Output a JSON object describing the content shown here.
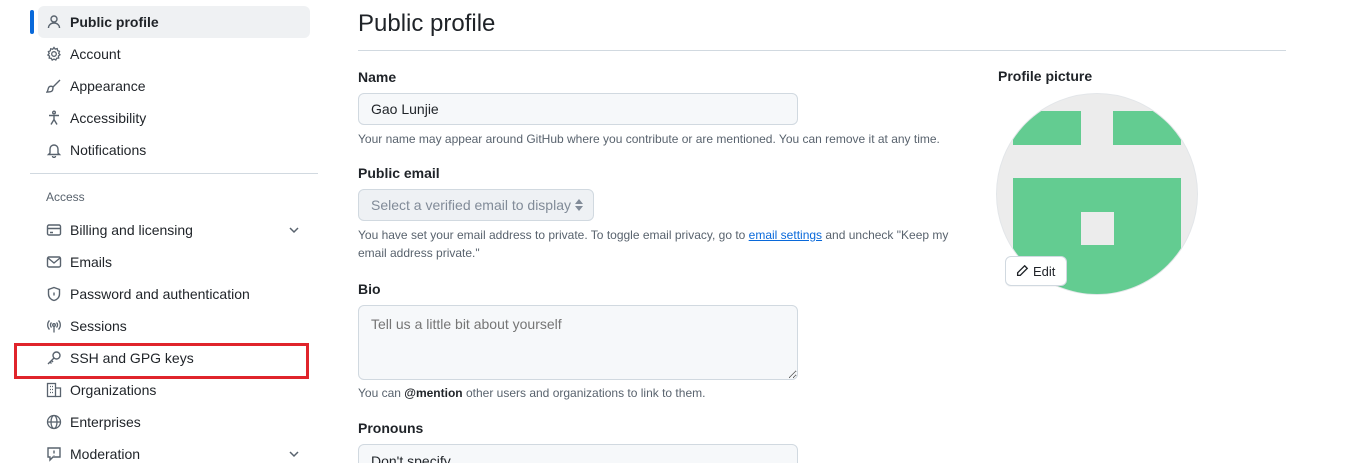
{
  "sidebar": {
    "items": [
      {
        "label": "Public profile",
        "icon": "person-icon"
      },
      {
        "label": "Account",
        "icon": "gear-icon"
      },
      {
        "label": "Appearance",
        "icon": "paintbrush-icon"
      },
      {
        "label": "Accessibility",
        "icon": "accessibility-icon"
      },
      {
        "label": "Notifications",
        "icon": "bell-icon"
      }
    ],
    "access_heading": "Access",
    "access_items": [
      {
        "label": "Billing and licensing",
        "icon": "credit-card-icon"
      },
      {
        "label": "Emails",
        "icon": "mail-icon"
      },
      {
        "label": "Password and authentication",
        "icon": "shield-lock-icon"
      },
      {
        "label": "Sessions",
        "icon": "broadcast-icon"
      },
      {
        "label": "SSH and GPG keys",
        "icon": "key-icon"
      },
      {
        "label": "Organizations",
        "icon": "organization-icon"
      },
      {
        "label": "Enterprises",
        "icon": "globe-icon"
      },
      {
        "label": "Moderation",
        "icon": "report-icon"
      }
    ]
  },
  "main": {
    "title": "Public profile",
    "name_label": "Name",
    "name_value": "Gao Lunjie",
    "name_note": "Your name may appear around GitHub where you contribute or are mentioned. You can remove it at any time.",
    "email_label": "Public email",
    "email_select": "Select a verified email to display",
    "email_note_pre": "You have set your email address to private. To toggle email privacy, go to ",
    "email_note_link": "email settings",
    "email_note_post": " and uncheck \"Keep my email address private.\"",
    "bio_label": "Bio",
    "bio_placeholder": "Tell us a little bit about yourself",
    "bio_note_pre": "You can ",
    "bio_note_mention": "@mention",
    "bio_note_post": " other users and organizations to link to them.",
    "pronouns_label": "Pronouns",
    "pronouns_value": "Don't specify"
  },
  "profile_picture": {
    "label": "Profile picture",
    "edit_label": "Edit",
    "identicon_color": "#63cc91"
  },
  "colors": {
    "accent": "#0969da",
    "highlight": "#e0242b"
  }
}
